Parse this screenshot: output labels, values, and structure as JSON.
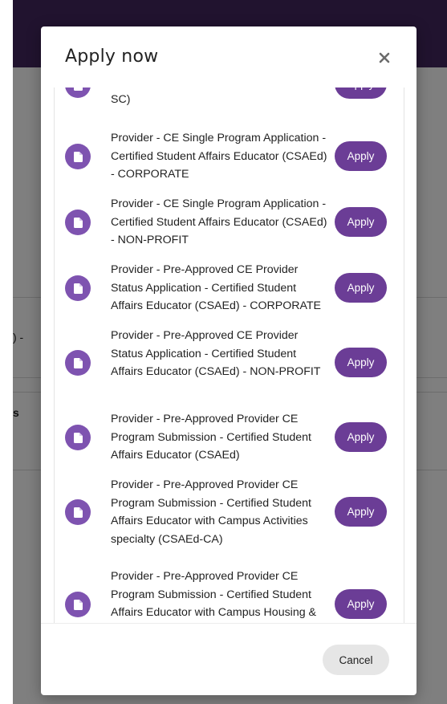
{
  "background": {
    "fragment_1": ") -",
    "fragment_2": "s"
  },
  "modal": {
    "title": "Apply now",
    "close_label": "×",
    "cancel_label": "Cancel",
    "items": [
      {
        "text": "Conduct Administration specialty (CSAEd-SC)",
        "apply_label": "Apply"
      },
      {
        "text": "Provider - CE Single Program Application - Certified Student Affairs Educator (CSAEd) - CORPORATE",
        "apply_label": "Apply"
      },
      {
        "text": "Provider - CE Single Program Application - Certified Student Affairs Educator (CSAEd) - NON-PROFIT",
        "apply_label": "Apply"
      },
      {
        "text": "Provider - Pre-Approved CE Provider Status Application - Certified Student Affairs Educator (CSAEd) - CORPORATE",
        "apply_label": "Apply"
      },
      {
        "text": "Provider - Pre-Approved CE Provider Status Application - Certified Student Affairs Educator (CSAEd) - NON-PROFIT",
        "apply_label": "Apply"
      },
      {
        "text": "Provider - Pre-Approved Provider CE Program Submission - Certified Student Affairs Educator (CSAEd)",
        "apply_label": "Apply"
      },
      {
        "text": "Provider - Pre-Approved Provider CE Program Submission - Certified Student Affairs Educator with Campus Activities specialty (CSAEd-CA)",
        "apply_label": "Apply"
      },
      {
        "text": "Provider - Pre-Approved Provider CE Program Submission - Certified Student Affairs Educator with Campus Housing & Residential Life specialty (CSAEd-",
        "apply_label": "Apply"
      }
    ]
  },
  "colors": {
    "topbar": "#42265e",
    "icon_circle": "#7e53b0",
    "apply_button": "#6b3d96",
    "cancel_button": "#e6e6e6"
  },
  "icons": {
    "item_icon": "document-icon",
    "close_icon": "close-icon"
  }
}
